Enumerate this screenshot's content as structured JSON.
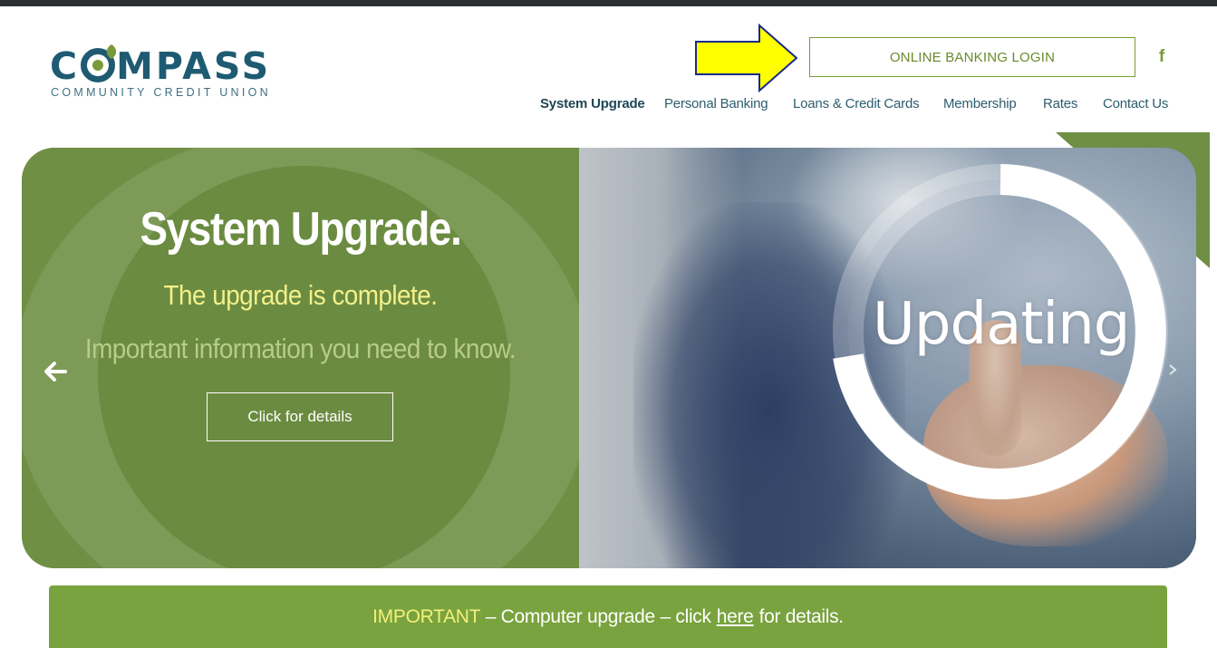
{
  "logo": {
    "word_left": "C",
    "word_right": "MPASS",
    "subtitle": "COMMUNITY CREDIT UNION"
  },
  "header": {
    "login_label": "ONLINE BANKING LOGIN",
    "facebook_glyph": "f"
  },
  "nav": {
    "items": [
      {
        "label": "System Upgrade",
        "active": true
      },
      {
        "label": "Personal Banking"
      },
      {
        "label": "Loans & Credit Cards"
      },
      {
        "label": "Membership"
      },
      {
        "label": "Rates"
      },
      {
        "label": "Contact Us"
      }
    ]
  },
  "hero": {
    "title": "System Upgrade.",
    "subtitle": "The upgrade is complete.",
    "info": "Important information you need to know.",
    "button_label": "Click for details",
    "image_text": "Updating"
  },
  "notice": {
    "important": "IMPORTANT",
    "text_before": " – Computer upgrade – click",
    "link": "here",
    "text_after": "for details."
  },
  "colors": {
    "brand_teal": "#1e5b72",
    "brand_green": "#7a9a3a",
    "hero_green": "#6f8f45",
    "notice_green": "#79a33e",
    "highlight_yellow": "#f2f08a",
    "annotation_arrow": "#ffff00"
  },
  "icons": {
    "facebook": "facebook-icon",
    "prev": "arrow-left-icon",
    "next": "chevron-right-icon",
    "annotation": "arrow-right-annotation-icon"
  }
}
